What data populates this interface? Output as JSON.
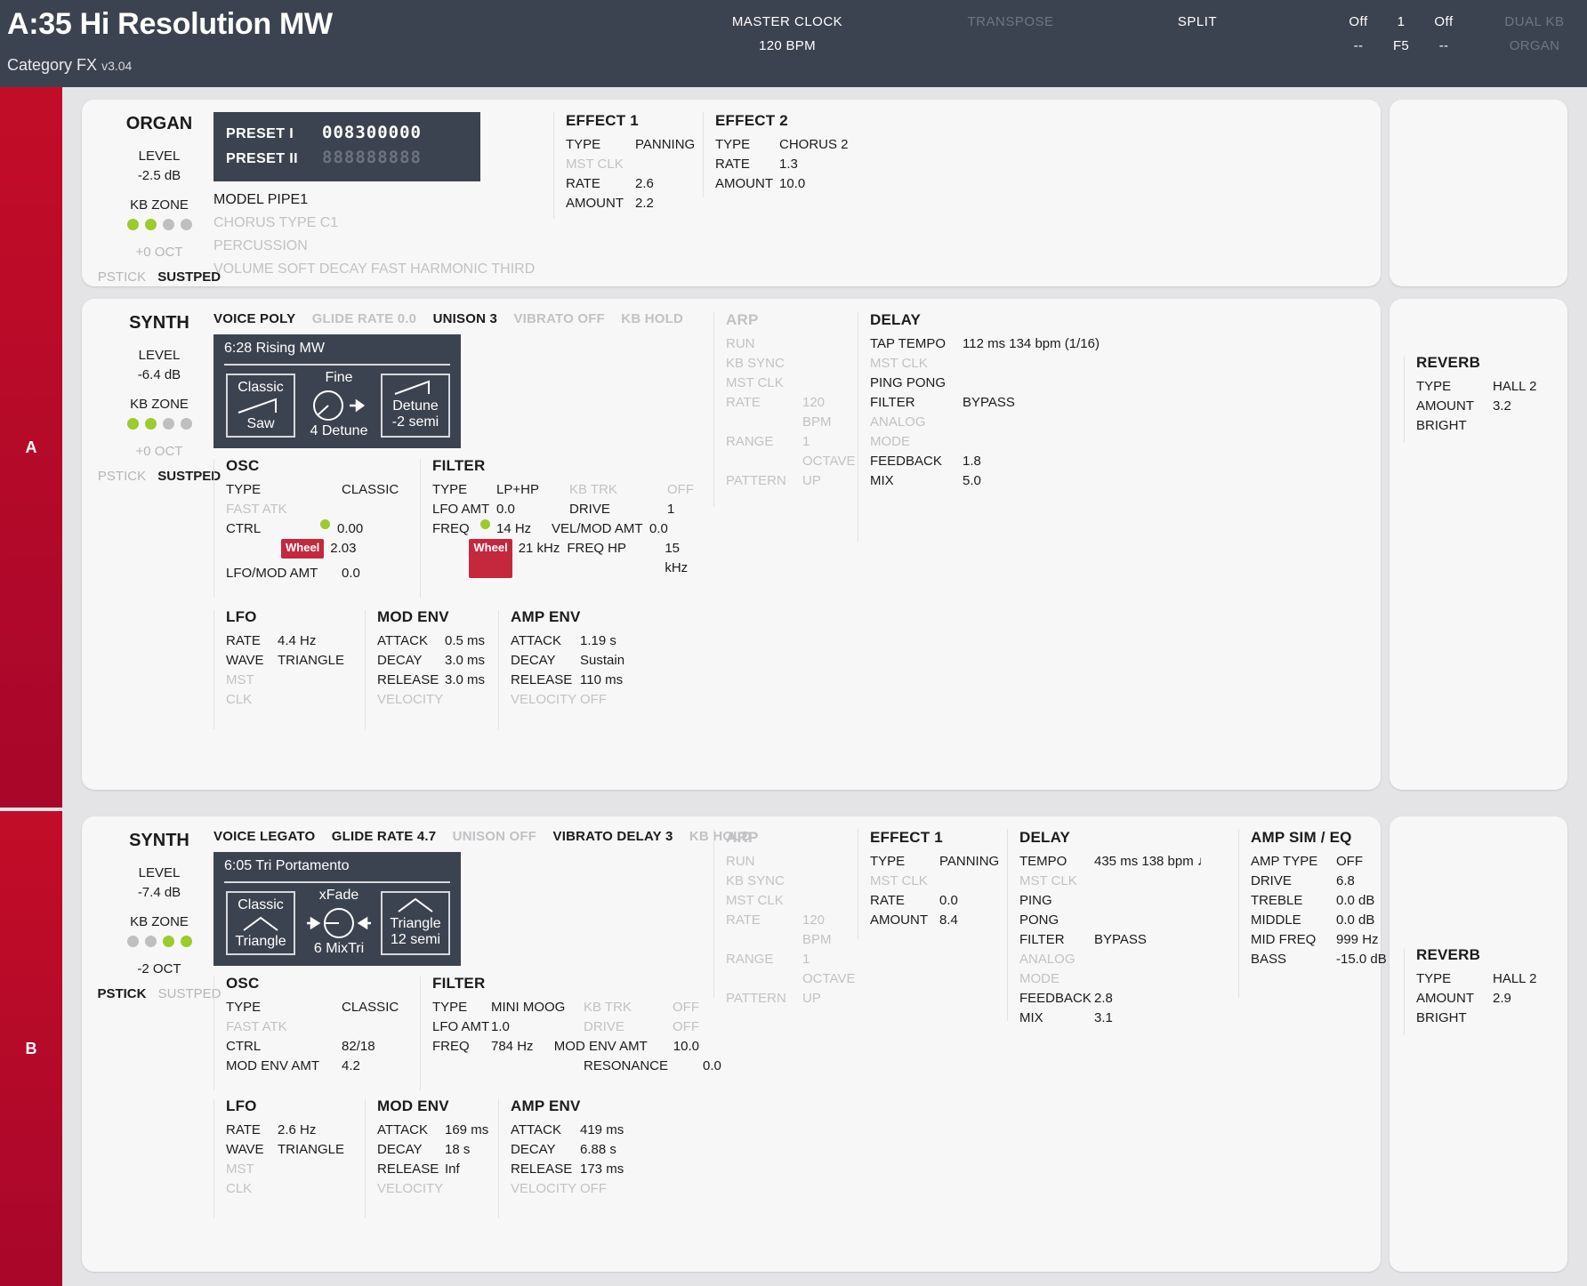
{
  "header": {
    "title": "A:35 Hi Resolution MW",
    "category_label": "Category FX",
    "version": "v3.04",
    "master_clock": {
      "label": "MASTER CLOCK",
      "value": "120 BPM"
    },
    "transpose": {
      "label": "TRANSPOSE",
      "value": ""
    },
    "split": {
      "label": "SPLIT",
      "value": ""
    },
    "split_zones": [
      {
        "state": "Off",
        "note": "--"
      },
      {
        "state": "1",
        "note": "F5"
      },
      {
        "state": "Off",
        "note": "--"
      }
    ],
    "dual_kb": {
      "label": "DUAL KB",
      "value": "ORGAN"
    }
  },
  "slots": {
    "a_label": "A",
    "b_label": "B"
  },
  "colors": {
    "accent_red": "#c30d28",
    "header_bg": "#3c4350",
    "led_green": "#9ccb2b",
    "wheel_red": "#c5283d"
  },
  "organ": {
    "title": "ORGAN",
    "level_label": "LEVEL",
    "level_value": "-2.5 dB",
    "kb_zone_label": "KB ZONE",
    "kb_zone_dots": [
      true,
      true,
      false,
      false
    ],
    "octave": "+0 OCT",
    "pstick": "PSTICK",
    "sustped": "SUSTPED",
    "preset1_label": "PRESET I",
    "preset1_value": "008300000",
    "preset2_label": "PRESET II",
    "preset2_value": "888888888",
    "model": "MODEL PIPE1",
    "chorus": "CHORUS  TYPE C1",
    "percussion": "PERCUSSION",
    "perc_params": "VOLUME SOFT  DECAY FAST  HARMONIC THIRD",
    "effect1": {
      "title": "EFFECT 1",
      "rows": [
        {
          "k": "TYPE",
          "v": "PANNING",
          "dim": false
        },
        {
          "k": "MST CLK",
          "v": "",
          "dim": true
        },
        {
          "k": "RATE",
          "v": "2.6",
          "dim": false
        },
        {
          "k": "AMOUNT",
          "v": "2.2",
          "dim": false
        }
      ]
    },
    "effect2": {
      "title": "EFFECT 2",
      "rows": [
        {
          "k": "TYPE",
          "v": "CHORUS 2",
          "dim": false
        },
        {
          "k": "RATE",
          "v": "1.3",
          "dim": false
        },
        {
          "k": "AMOUNT",
          "v": "10.0",
          "dim": false
        }
      ]
    }
  },
  "synth_a": {
    "title": "SYNTH",
    "level_label": "LEVEL",
    "level_value": "-6.4 dB",
    "kb_zone_label": "KB ZONE",
    "kb_zone_dots": [
      true,
      true,
      false,
      false
    ],
    "octave": "+0 OCT",
    "pstick": "PSTICK",
    "sustped": "SUSTPED",
    "pstick_on": false,
    "sustped_on": true,
    "topstrip": [
      {
        "t": "VOICE POLY",
        "on": true
      },
      {
        "t": "GLIDE RATE 0.0",
        "on": false
      },
      {
        "t": "UNISON 3",
        "on": true
      },
      {
        "t": "VIBRATO OFF",
        "on": false
      },
      {
        "t": "KB HOLD",
        "on": false
      }
    ],
    "oscbox": {
      "name": "6:28 Rising MW",
      "left_top": "Classic",
      "left_wave": "saw",
      "left_bottom": "Saw",
      "mid_top": "Fine",
      "mid_bottom": "4 Detune",
      "knob": "knob-icon",
      "arrow": "arrow-right-icon",
      "right_wave": "saw",
      "right_top": "Detune",
      "right_bottom": "-2 semi"
    },
    "osc": {
      "title": "OSC",
      "rows": [
        {
          "k": "TYPE",
          "v": "CLASSIC",
          "dim": false
        },
        {
          "k": "FAST ATK",
          "v": "",
          "dim": true
        },
        {
          "k": "CTRL",
          "v": "0.00",
          "dim": false,
          "led": true
        },
        {
          "k": "",
          "v": "2.03",
          "dim": false,
          "wheel": "Wheel"
        },
        {
          "k": "LFO/MOD AMT",
          "v": "0.0",
          "dim": false
        }
      ]
    },
    "filter": {
      "title": "FILTER",
      "rows": [
        {
          "k": "TYPE",
          "v": "LP+HP",
          "k2": "KB TRK",
          "v2": "OFF",
          "dim": false,
          "dim2": true
        },
        {
          "k": "LFO AMT",
          "v": "0.0",
          "k2": "DRIVE",
          "v2": "1",
          "dim": false,
          "dim2": false
        },
        {
          "k": "FREQ",
          "v": "14 Hz",
          "k2": "VEL/MOD AMT",
          "v2": "0.0",
          "dim": false,
          "dim2": false,
          "led": true
        },
        {
          "k": "",
          "v": "21 kHz",
          "k2": "FREQ HP",
          "v2": "15 kHz",
          "dim": false,
          "dim2": false,
          "wheel": "Wheel"
        }
      ]
    },
    "lfo": {
      "title": "LFO",
      "rows": [
        {
          "k": "RATE",
          "v": "4.4 Hz",
          "dim": false
        },
        {
          "k": "WAVE",
          "v": "TRIANGLE",
          "dim": false
        },
        {
          "k": "MST CLK",
          "v": "",
          "dim": true
        }
      ]
    },
    "mod_env": {
      "title": "MOD ENV",
      "rows": [
        {
          "k": "ATTACK",
          "v": "0.5 ms",
          "dim": false
        },
        {
          "k": "DECAY",
          "v": "3.0 ms",
          "dim": false
        },
        {
          "k": "RELEASE",
          "v": "3.0 ms",
          "dim": false
        },
        {
          "k": "VELOCITY",
          "v": "",
          "dim": true
        }
      ]
    },
    "amp_env": {
      "title": "AMP ENV",
      "rows": [
        {
          "k": "ATTACK",
          "v": "1.19 s",
          "dim": false
        },
        {
          "k": "DECAY",
          "v": "Sustain",
          "dim": false
        },
        {
          "k": "RELEASE",
          "v": "110 ms",
          "dim": false
        },
        {
          "k": "VELOCITY",
          "v": "OFF",
          "dim": true
        }
      ]
    },
    "arp": {
      "title": "ARP",
      "rows": [
        {
          "k": "RUN",
          "v": "",
          "dim": true
        },
        {
          "k": "KB SYNC",
          "v": "",
          "dim": true
        },
        {
          "k": "MST CLK",
          "v": "",
          "dim": true
        },
        {
          "k": "RATE",
          "v": "120 BPM",
          "dim": true
        },
        {
          "k": "RANGE",
          "v": "1 OCTAVE",
          "dim": true
        },
        {
          "k": "PATTERN",
          "v": "UP",
          "dim": true
        }
      ]
    },
    "delay": {
      "title": "DELAY",
      "rows": [
        {
          "k": "TAP TEMPO",
          "v": "112 ms 134 bpm (1/16)",
          "dim": false
        },
        {
          "k": "MST CLK",
          "v": "",
          "dim": true
        },
        {
          "k": "PING PONG",
          "v": "",
          "dim": false
        },
        {
          "k": "FILTER",
          "v": "BYPASS",
          "dim": false
        },
        {
          "k": "ANALOG MODE",
          "v": "",
          "dim": true
        },
        {
          "k": "FEEDBACK",
          "v": "1.8",
          "dim": false
        },
        {
          "k": "MIX",
          "v": "5.0",
          "dim": false
        }
      ]
    },
    "reverb": {
      "title": "REVERB",
      "rows": [
        {
          "k": "TYPE",
          "v": "HALL 2",
          "dim": false
        },
        {
          "k": "AMOUNT",
          "v": "3.2",
          "dim": false
        },
        {
          "k": "BRIGHT",
          "v": "",
          "dim": false
        }
      ]
    }
  },
  "synth_b": {
    "title": "SYNTH",
    "level_label": "LEVEL",
    "level_value": "-7.4 dB",
    "kb_zone_label": "KB ZONE",
    "kb_zone_dots": [
      false,
      false,
      true,
      true
    ],
    "octave": "-2 OCT",
    "pstick": "PSTICK",
    "sustped": "SUSTPED",
    "pstick_on": true,
    "sustped_on": false,
    "topstrip": [
      {
        "t": "VOICE LEGATO",
        "on": true
      },
      {
        "t": "GLIDE RATE 4.7",
        "on": true
      },
      {
        "t": "UNISON OFF",
        "on": false
      },
      {
        "t": "VIBRATO DELAY 3",
        "on": true
      },
      {
        "t": "KB HOLD",
        "on": false
      }
    ],
    "oscbox": {
      "name": "6:05 Tri Portamento",
      "left_top": "Classic",
      "left_wave": "triangle",
      "left_bottom": "Triangle",
      "mid_top": "xFade",
      "mid_bottom": "6 MixTri",
      "knob": "knob-icon",
      "arrow": "arrow-both-icon",
      "right_wave": "triangle",
      "right_top": "Triangle",
      "right_bottom": "12 semi"
    },
    "osc": {
      "title": "OSC",
      "rows": [
        {
          "k": "TYPE",
          "v": "CLASSIC",
          "dim": false
        },
        {
          "k": "FAST ATK",
          "v": "",
          "dim": true
        },
        {
          "k": "CTRL",
          "v": "82/18",
          "dim": false
        },
        {
          "k": "MOD ENV AMT",
          "v": "4.2",
          "dim": false
        }
      ]
    },
    "filter": {
      "title": "FILTER",
      "rows": [
        {
          "k": "TYPE",
          "v": "MINI MOOG",
          "k2": "KB TRK",
          "v2": "OFF",
          "dim": false,
          "dim2": true
        },
        {
          "k": "LFO AMT",
          "v": "1.0",
          "k2": "DRIVE",
          "v2": "OFF",
          "dim": false,
          "dim2": true
        },
        {
          "k": "FREQ",
          "v": "784 Hz",
          "k2": "MOD ENV AMT",
          "v2": "10.0",
          "dim": false,
          "dim2": false
        },
        {
          "k": "",
          "v": "",
          "k2": "RESONANCE",
          "v2": "0.0",
          "dim": false,
          "dim2": false
        }
      ]
    },
    "lfo": {
      "title": "LFO",
      "rows": [
        {
          "k": "RATE",
          "v": "2.6 Hz",
          "dim": false
        },
        {
          "k": "WAVE",
          "v": "TRIANGLE",
          "dim": false
        },
        {
          "k": "MST CLK",
          "v": "",
          "dim": true
        }
      ]
    },
    "mod_env": {
      "title": "MOD ENV",
      "rows": [
        {
          "k": "ATTACK",
          "v": "169 ms",
          "dim": false
        },
        {
          "k": "DECAY",
          "v": "18 s",
          "dim": false
        },
        {
          "k": "RELEASE",
          "v": "Inf",
          "dim": false
        },
        {
          "k": "VELOCITY",
          "v": "",
          "dim": true
        }
      ]
    },
    "amp_env": {
      "title": "AMP ENV",
      "rows": [
        {
          "k": "ATTACK",
          "v": "419 ms",
          "dim": false
        },
        {
          "k": "DECAY",
          "v": "6.88 s",
          "dim": false
        },
        {
          "k": "RELEASE",
          "v": "173 ms",
          "dim": false
        },
        {
          "k": "VELOCITY",
          "v": "OFF",
          "dim": true
        }
      ]
    },
    "arp": {
      "title": "ARP",
      "rows": [
        {
          "k": "RUN",
          "v": "",
          "dim": true
        },
        {
          "k": "KB SYNC",
          "v": "",
          "dim": true
        },
        {
          "k": "MST CLK",
          "v": "",
          "dim": true
        },
        {
          "k": "RATE",
          "v": "120 BPM",
          "dim": true
        },
        {
          "k": "RANGE",
          "v": "1 OCTAVE",
          "dim": true
        },
        {
          "k": "PATTERN",
          "v": "UP",
          "dim": true
        }
      ]
    },
    "effect1": {
      "title": "EFFECT 1",
      "rows": [
        {
          "k": "TYPE",
          "v": "PANNING",
          "dim": false
        },
        {
          "k": "MST CLK",
          "v": "",
          "dim": true
        },
        {
          "k": "RATE",
          "v": "0.0",
          "dim": false
        },
        {
          "k": "AMOUNT",
          "v": "8.4",
          "dim": false
        }
      ]
    },
    "delay": {
      "title": "DELAY",
      "rows": [
        {
          "k": "TEMPO",
          "v": "435 ms 138 bpm ♩",
          "dim": false
        },
        {
          "k": "MST CLK",
          "v": "",
          "dim": true
        },
        {
          "k": "PING PONG",
          "v": "",
          "dim": false
        },
        {
          "k": "FILTER",
          "v": "BYPASS",
          "dim": false
        },
        {
          "k": "ANALOG MODE",
          "v": "",
          "dim": true
        },
        {
          "k": "FEEDBACK",
          "v": "2.8",
          "dim": false
        },
        {
          "k": "MIX",
          "v": "3.1",
          "dim": false
        }
      ]
    },
    "amp_sim": {
      "title": "AMP SIM / EQ",
      "rows": [
        {
          "k": "AMP TYPE",
          "v": "OFF",
          "dim": false
        },
        {
          "k": "DRIVE",
          "v": "6.8",
          "dim": false
        },
        {
          "k": "TREBLE",
          "v": "0.0 dB",
          "dim": false
        },
        {
          "k": "MIDDLE",
          "v": "0.0 dB",
          "dim": false
        },
        {
          "k": "MID FREQ",
          "v": "999 Hz",
          "dim": false
        },
        {
          "k": "BASS",
          "v": "-15.0 dB",
          "dim": false
        }
      ]
    },
    "reverb": {
      "title": "REVERB",
      "rows": [
        {
          "k": "TYPE",
          "v": "HALL 2",
          "dim": false
        },
        {
          "k": "AMOUNT",
          "v": "2.9",
          "dim": false
        },
        {
          "k": "BRIGHT",
          "v": "",
          "dim": false
        }
      ]
    }
  }
}
